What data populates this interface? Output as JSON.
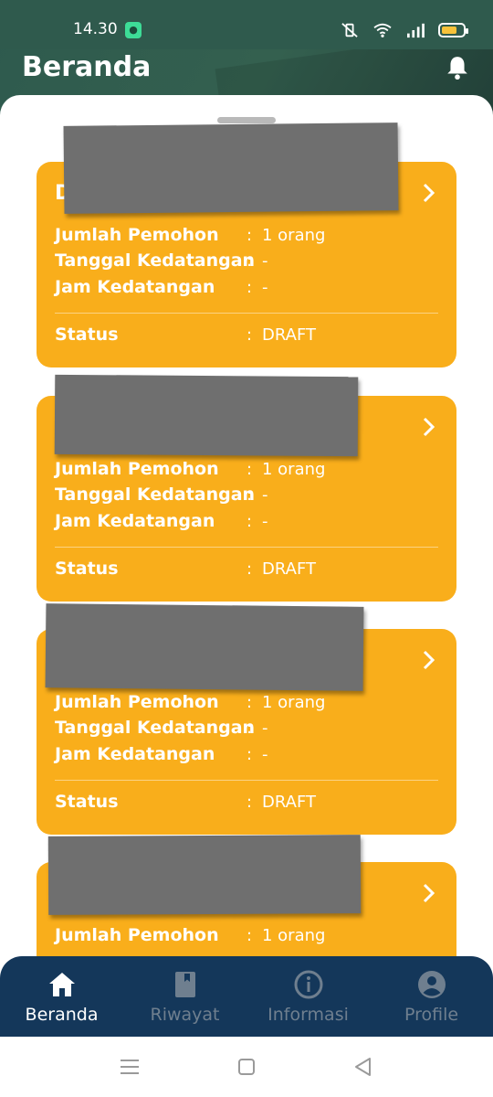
{
  "status_bar": {
    "time": "14.30"
  },
  "header": {
    "title": "Beranda"
  },
  "cards": [
    {
      "title": "D",
      "rows": [
        {
          "label": "Jumlah Pemohon",
          "value": "1 orang"
        },
        {
          "label": "Tanggal Kedatangan",
          "value": "-"
        },
        {
          "label": "Jam Kedatangan",
          "value": "-"
        }
      ],
      "status_label": "Status",
      "status_value": "DRAFT"
    },
    {
      "title": "",
      "rows": [
        {
          "label": "Jumlah Pemohon",
          "value": "1 orang"
        },
        {
          "label": "Tanggal Kedatangan",
          "value": "-"
        },
        {
          "label": "Jam Kedatangan",
          "value": "-"
        }
      ],
      "status_label": "Status",
      "status_value": "DRAFT"
    },
    {
      "title": "",
      "rows": [
        {
          "label": "Jumlah Pemohon",
          "value": "1 orang"
        },
        {
          "label": "Tanggal Kedatangan",
          "value": "-"
        },
        {
          "label": "Jam Kedatangan",
          "value": "-"
        }
      ],
      "status_label": "Status",
      "status_value": "DRAFT"
    },
    {
      "title": "",
      "rows": [
        {
          "label": "Jumlah Pemohon",
          "value": "1 orang"
        }
      ]
    }
  ],
  "bottom_nav": [
    {
      "label": "Beranda",
      "icon": "home-icon",
      "active": true
    },
    {
      "label": "Riwayat",
      "icon": "book-icon",
      "active": false
    },
    {
      "label": "Informasi",
      "icon": "info-icon",
      "active": false
    },
    {
      "label": "Profile",
      "icon": "user-circle-icon",
      "active": false
    }
  ],
  "colors": {
    "card": "#f9ae1b",
    "header": "#2f5a4d",
    "nav": "#14375a",
    "nav_inactive": "#6f7f8f"
  }
}
